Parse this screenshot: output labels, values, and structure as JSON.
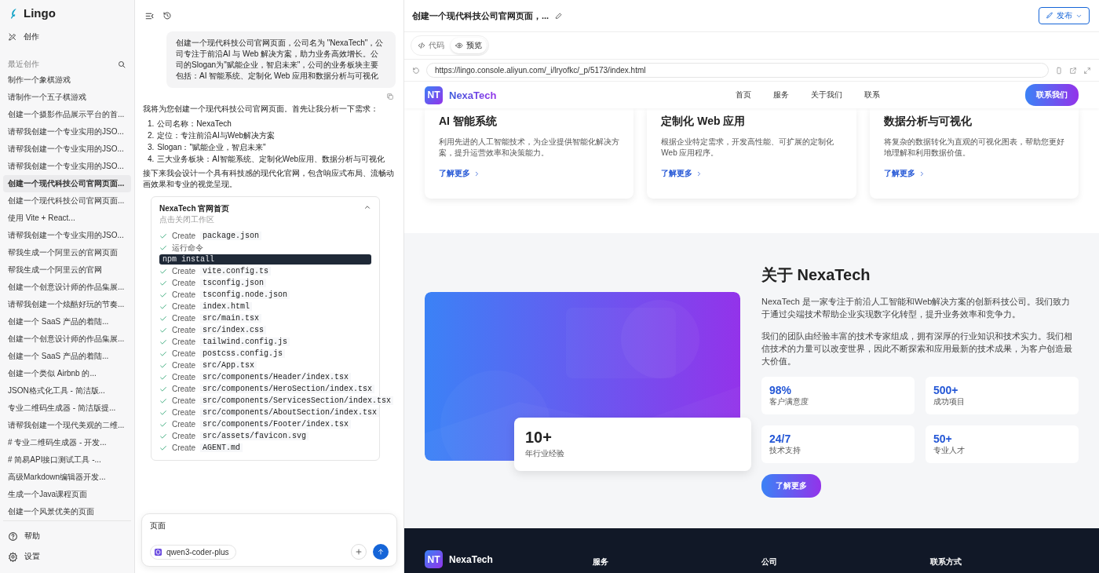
{
  "app": {
    "name": "Lingo"
  },
  "sidebar": {
    "create_label": "创作",
    "recent_label": "最近创作",
    "items": [
      {
        "label": "制作一个象棋游戏",
        "selected": false
      },
      {
        "label": "请制作一个五子棋游戏",
        "selected": false
      },
      {
        "label": "创建一个摄影作品展示平台的首...",
        "selected": false
      },
      {
        "label": "请帮我创建一个专业实用的JSO...",
        "selected": false
      },
      {
        "label": "请帮我创建一个专业实用的JSO...",
        "selected": false
      },
      {
        "label": "请帮我创建一个专业实用的JSO...",
        "selected": false
      },
      {
        "label": "创建一个现代科技公司官网页面...",
        "selected": true
      },
      {
        "label": "创建一个现代科技公司官网页面...",
        "selected": false
      },
      {
        "label": "使用 Vite + React...",
        "selected": false
      },
      {
        "label": "请帮我创建一个专业实用的JSO...",
        "selected": false
      },
      {
        "label": "帮我生成一个阿里云的官网页面",
        "selected": false
      },
      {
        "label": "帮我生成一个阿里云的官网",
        "selected": false
      },
      {
        "label": "创建一个创意设计师的作品集展...",
        "selected": false
      },
      {
        "label": "请帮我创建一个炫酷好玩的节奏...",
        "selected": false
      },
      {
        "label": "创建一个 SaaS 产品的着陆...",
        "selected": false
      },
      {
        "label": "创建一个创意设计师的作品集展...",
        "selected": false
      },
      {
        "label": "创建一个 SaaS 产品的着陆...",
        "selected": false
      },
      {
        "label": "创建一个类似 Airbnb 的...",
        "selected": false
      },
      {
        "label": "JSON格式化工具 - 简洁版...",
        "selected": false
      },
      {
        "label": "专业二维码生成器 - 简洁版提...",
        "selected": false
      },
      {
        "label": "请帮我创建一个现代美观的二维...",
        "selected": false
      },
      {
        "label": "# 专业二维码生成器 - 开发...",
        "selected": false
      },
      {
        "label": "# 简易API接口测试工具 -...",
        "selected": false
      },
      {
        "label": "高级Markdown编辑器开发...",
        "selected": false
      },
      {
        "label": "生成一个Java课程页面",
        "selected": false
      },
      {
        "label": "创建一个风景优美的页面",
        "selected": false
      }
    ],
    "bottom_items": [
      {
        "kind": "help",
        "label": "帮助"
      },
      {
        "kind": "settings",
        "label": "设置"
      }
    ]
  },
  "chat": {
    "user_message": "创建一个现代科技公司官网页面，公司名为 \"NexaTech\"，公司专注于前沿AI 与 Web 解决方案，助力业务高效增长。公司的Slogan为\"赋能企业，智启未来\"，公司的业务板块主要包括：AI 智能系统、定制化 Web 应用和数据分析与可视化",
    "reply_intro": "我将为您创建一个现代科技公司官网页面。首先让我分析一下需求：",
    "reply_points": [
      {
        "marker": "1.",
        "text": "公司名称：NexaTech"
      },
      {
        "marker": "2.",
        "text": "定位：专注前沿AI与Web解决方案"
      },
      {
        "marker": "3.",
        "text": "Slogan：\"赋能企业，智启未来\""
      },
      {
        "marker": "4.",
        "text": "三大业务板块：AI智能系统、定制化Web应用、数据分析与可视化"
      }
    ],
    "reply_outro": "接下来我会设计一个具有科技感的现代化官网，包含响应式布局、流畅动画效果和专业的视觉呈现。",
    "workspace": {
      "title": "NexaTech 官网首页",
      "subtitle": "点击关闭工作区",
      "expanded": true,
      "steps": [
        {
          "kind": "create",
          "verb": "Create",
          "path": "package.json"
        },
        {
          "kind": "step",
          "label": "运行命令"
        },
        {
          "kind": "terminal",
          "command": "npm install"
        },
        {
          "kind": "create",
          "verb": "Create",
          "path": "vite.config.ts"
        },
        {
          "kind": "create",
          "verb": "Create",
          "path": "tsconfig.json"
        },
        {
          "kind": "create",
          "verb": "Create",
          "path": "tsconfig.node.json"
        },
        {
          "kind": "create",
          "verb": "Create",
          "path": "index.html"
        },
        {
          "kind": "create",
          "verb": "Create",
          "path": "src/main.tsx"
        },
        {
          "kind": "create",
          "verb": "Create",
          "path": "src/index.css"
        },
        {
          "kind": "create",
          "verb": "Create",
          "path": "tailwind.config.js"
        },
        {
          "kind": "create",
          "verb": "Create",
          "path": "postcss.config.js"
        },
        {
          "kind": "create",
          "verb": "Create",
          "path": "src/App.tsx"
        },
        {
          "kind": "create",
          "verb": "Create",
          "path": "src/components/Header/index.tsx"
        },
        {
          "kind": "create",
          "verb": "Create",
          "path": "src/components/HeroSection/index.tsx"
        },
        {
          "kind": "create",
          "verb": "Create",
          "path": "src/components/ServicesSection/index.tsx"
        },
        {
          "kind": "create",
          "verb": "Create",
          "path": "src/components/AboutSection/index.tsx"
        },
        {
          "kind": "create",
          "verb": "Create",
          "path": "src/components/Footer/index.tsx"
        },
        {
          "kind": "create",
          "verb": "Create",
          "path": "src/assets/favicon.svg"
        },
        {
          "kind": "create",
          "verb": "Create",
          "path": "AGENT.md"
        }
      ]
    },
    "input": {
      "value": "页面",
      "model": "qwen3-coder-plus"
    }
  },
  "preview": {
    "title": "创建一个现代科技公司官网页面，...",
    "publish_label": "发布",
    "tabs": [
      {
        "kind": "code",
        "label": "代码",
        "selected": false
      },
      {
        "kind": "preview",
        "label": "预览",
        "selected": true
      }
    ],
    "url": "https://lingo.console.aliyun.com/_i/lryofkc/_p/5173/index.html",
    "site": {
      "logo_mark": "NT",
      "brand": "NexaTech",
      "nav": [
        "首页",
        "服务",
        "关于我们",
        "联系"
      ],
      "cta": "联系我们",
      "services": [
        {
          "title": "AI 智能系统",
          "description": "利用先进的人工智能技术，为企业提供智能化解决方案，提升运营效率和决策能力。",
          "link": "了解更多"
        },
        {
          "title": "定制化 Web 应用",
          "description": "根据企业特定需求，开发高性能、可扩展的定制化 Web 应用程序。",
          "link": "了解更多"
        },
        {
          "title": "数据分析与可视化",
          "description": "将复杂的数据转化为直观的可视化图表，帮助您更好地理解和利用数据价值。",
          "link": "了解更多"
        }
      ],
      "about": {
        "badge_value": "10+",
        "badge_label": "年行业经验",
        "heading": "关于 NexaTech",
        "paragraphs": [
          "NexaTech 是一家专注于前沿人工智能和Web解决方案的创新科技公司。我们致力于通过尖端技术帮助企业实现数字化转型，提升业务效率和竞争力。",
          "我们的团队由经验丰富的技术专家组成，拥有深厚的行业知识和技术实力。我们相信技术的力量可以改变世界，因此不断探索和应用最新的技术成果，为客户创造最大价值。"
        ],
        "stats": [
          {
            "value": "98%",
            "label": "客户满意度"
          },
          {
            "value": "500+",
            "label": "成功项目"
          },
          {
            "value": "24/7",
            "label": "技术支持"
          },
          {
            "value": "50+",
            "label": "专业人才"
          }
        ],
        "button": "了解更多"
      },
      "footer": {
        "logo_mark": "NT",
        "brand": "NexaTech",
        "columns": [
          "服务",
          "公司",
          "联系方式"
        ]
      }
    }
  }
}
